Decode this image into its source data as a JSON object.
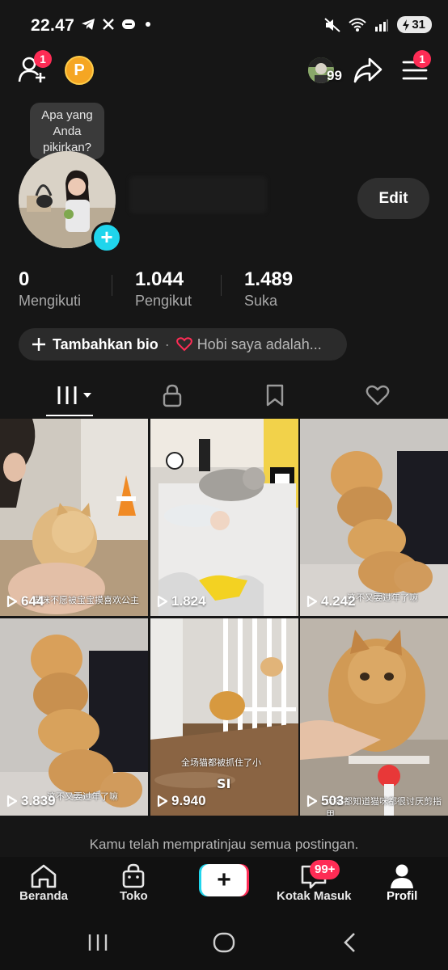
{
  "status_bar": {
    "time": "22.47",
    "battery": "31"
  },
  "top_bar": {
    "add_friends_badge": "1",
    "coin_letter": "P",
    "avatar_count": "99",
    "menu_badge": "1"
  },
  "profile": {
    "tooltip": "Apa yang Anda pikirkan?",
    "edit_label": "Edit",
    "stats": [
      {
        "value": "0",
        "label": "Mengikuti"
      },
      {
        "value": "1.044",
        "label": "Pengikut"
      },
      {
        "value": "1.489",
        "label": "Suka"
      }
    ],
    "bio_add_label": "Tambahkan bio",
    "bio_separator": "·",
    "bio_hint": "Hobi saya adalah..."
  },
  "tabs": [
    "videos",
    "private",
    "saved",
    "liked"
  ],
  "videos": [
    {
      "views": "644",
      "caption": "猫咪不愿被宝宝摸喜欢公主"
    },
    {
      "views": "1.824",
      "caption": ""
    },
    {
      "views": "4.242",
      "caption": "这不又要过年了嘛"
    },
    {
      "views": "3.839",
      "caption": "这不又要过年了嘛"
    },
    {
      "views": "9.940",
      "caption": "全场猫都被抓住了小",
      "caption2": "SI"
    },
    {
      "views": "503",
      "caption": "大家都知道猫咪都很讨厌剪指甲"
    }
  ],
  "footer_note": "Kamu telah mempratinjau semua postingan.",
  "bottom_nav": [
    {
      "label": "Beranda"
    },
    {
      "label": "Toko"
    },
    {
      "label": ""
    },
    {
      "label": "Kotak Masuk",
      "badge": "99+"
    },
    {
      "label": "Profil"
    }
  ],
  "colors": {
    "accent": "#fe2c55",
    "teal": "#20d5ec",
    "background": "#161616"
  }
}
